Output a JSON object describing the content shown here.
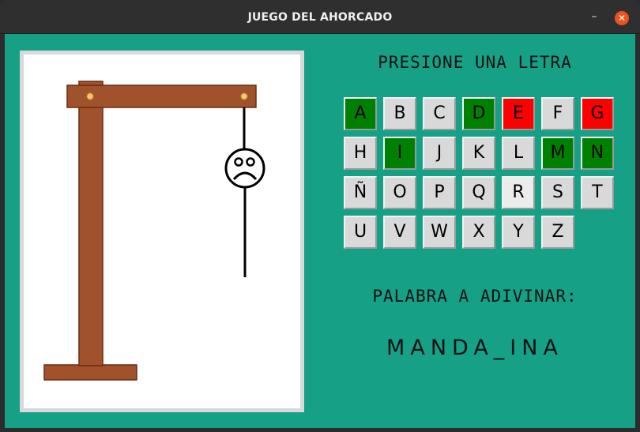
{
  "window": {
    "title": "JUEGO DEL AHORCADO",
    "minimize_glyph": "–",
    "close_glyph": "✕"
  },
  "prompt": "PRESIONE UNA LETRA",
  "keyboard": [
    {
      "letter": "A",
      "state": "correct"
    },
    {
      "letter": "B",
      "state": "unused"
    },
    {
      "letter": "C",
      "state": "unused"
    },
    {
      "letter": "D",
      "state": "correct"
    },
    {
      "letter": "E",
      "state": "wrong"
    },
    {
      "letter": "F",
      "state": "unused"
    },
    {
      "letter": "G",
      "state": "wrong"
    },
    {
      "letter": "H",
      "state": "unused"
    },
    {
      "letter": "I",
      "state": "correct"
    },
    {
      "letter": "J",
      "state": "unused"
    },
    {
      "letter": "K",
      "state": "unused"
    },
    {
      "letter": "L",
      "state": "unused"
    },
    {
      "letter": "M",
      "state": "correct"
    },
    {
      "letter": "N",
      "state": "correct"
    },
    {
      "letter": "Ñ",
      "state": "unused"
    },
    {
      "letter": "O",
      "state": "unused"
    },
    {
      "letter": "P",
      "state": "unused"
    },
    {
      "letter": "Q",
      "state": "unused"
    },
    {
      "letter": "R",
      "state": "hover"
    },
    {
      "letter": "S",
      "state": "unused"
    },
    {
      "letter": "T",
      "state": "unused"
    },
    {
      "letter": "U",
      "state": "unused"
    },
    {
      "letter": "V",
      "state": "unused"
    },
    {
      "letter": "W",
      "state": "unused"
    },
    {
      "letter": "X",
      "state": "unused"
    },
    {
      "letter": "Y",
      "state": "unused"
    },
    {
      "letter": "Z",
      "state": "unused"
    }
  ],
  "word_label": "PALABRA A ADIVINAR:",
  "word": "MANDA_INA",
  "colors": {
    "background": "#16a085",
    "correct": "#008000",
    "wrong": "#ff0000",
    "unused": "#d9d9d9",
    "gallows_wood": "#a0522d",
    "close_button": "#e95420"
  },
  "drawing": {
    "parts_shown": [
      "gallows",
      "rope",
      "sad-face-head"
    ]
  }
}
